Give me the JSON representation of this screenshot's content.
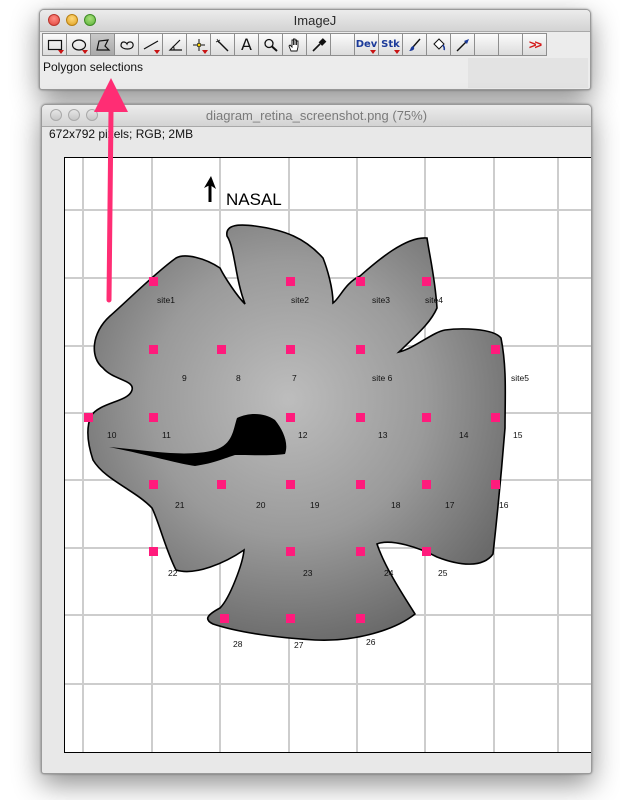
{
  "imagej": {
    "title": "ImageJ",
    "status_text": "Polygon selections",
    "tools": [
      {
        "name": "rectangle-tool-icon",
        "active": false,
        "has_menu": true
      },
      {
        "name": "oval-tool-icon",
        "active": false,
        "has_menu": true
      },
      {
        "name": "polygon-tool-icon",
        "active": true,
        "has_menu": false
      },
      {
        "name": "freehand-tool-icon",
        "active": false,
        "has_menu": false
      },
      {
        "name": "line-tool-icon",
        "active": false,
        "has_menu": true
      },
      {
        "name": "angle-tool-icon",
        "active": false,
        "has_menu": false
      },
      {
        "name": "point-tool-icon",
        "active": false,
        "has_menu": true
      },
      {
        "name": "wand-tool-icon",
        "active": false,
        "has_menu": false
      },
      {
        "name": "text-tool-icon",
        "label": "A",
        "active": false,
        "has_menu": false
      },
      {
        "name": "magnifier-tool-icon",
        "active": false,
        "has_menu": false
      },
      {
        "name": "hand-tool-icon",
        "active": false,
        "has_menu": false
      },
      {
        "name": "color-picker-tool-icon",
        "active": false,
        "has_menu": false
      },
      {
        "name": "empty-slot",
        "active": false,
        "has_menu": false
      },
      {
        "name": "developer-menu-icon",
        "label": "Dev",
        "active": false,
        "has_menu": true
      },
      {
        "name": "stack-menu-icon",
        "label": "Stk",
        "active": false,
        "has_menu": true
      },
      {
        "name": "brush-tool-icon",
        "active": false,
        "has_menu": false
      },
      {
        "name": "flood-fill-tool-icon",
        "active": false,
        "has_menu": false
      },
      {
        "name": "arrow-tool-icon",
        "active": false,
        "has_menu": false
      },
      {
        "name": "empty-slot",
        "active": false,
        "has_menu": false
      },
      {
        "name": "empty-slot",
        "active": false,
        "has_menu": false
      },
      {
        "name": "more-tools-icon",
        "label": ">>",
        "active": false,
        "has_menu": false
      }
    ]
  },
  "image_window": {
    "title": "diagram_retina_screenshot.png (75%)",
    "info": "672x792 pixels; RGB; 2MB",
    "annotation_color": "#ff2d74",
    "diagram": {
      "orientation_label": "NASAL",
      "site_labels": [
        "site1",
        "site2",
        "site3",
        "site4",
        "site5",
        "site 6"
      ],
      "number_labels": [
        "9",
        "8",
        "7",
        "10",
        "11",
        "12",
        "13",
        "14",
        "15",
        "21",
        "20",
        "19",
        "18",
        "17",
        "16",
        "22",
        "23",
        "24",
        "25",
        "28",
        "27",
        "26"
      ]
    }
  }
}
